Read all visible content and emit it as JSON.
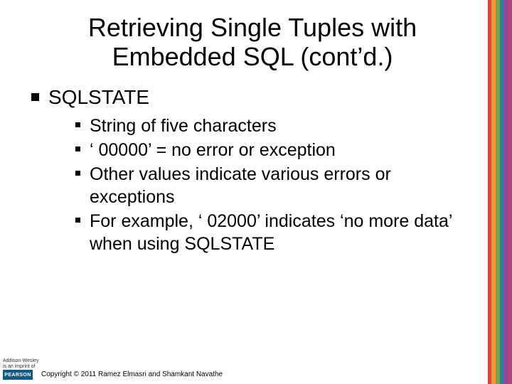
{
  "title": "Retrieving Single Tuples with Embedded SQL (cont’d.)",
  "outer": {
    "label": "SQLSTATE",
    "items": [
      "String of five characters",
      "‘ 00000’ = no error or exception",
      "Other values indicate various errors or exceptions",
      "For example, ‘ 02000’ indicates ‘no more data’ when using SQLSTATE"
    ]
  },
  "footer": {
    "publisher_line1": "Addison-Wesley",
    "publisher_line2": "is an imprint of",
    "brand": "PEARSON",
    "copyright": "Copyright © 2011 Ramez Elmasri and Shamkant Navathe"
  }
}
